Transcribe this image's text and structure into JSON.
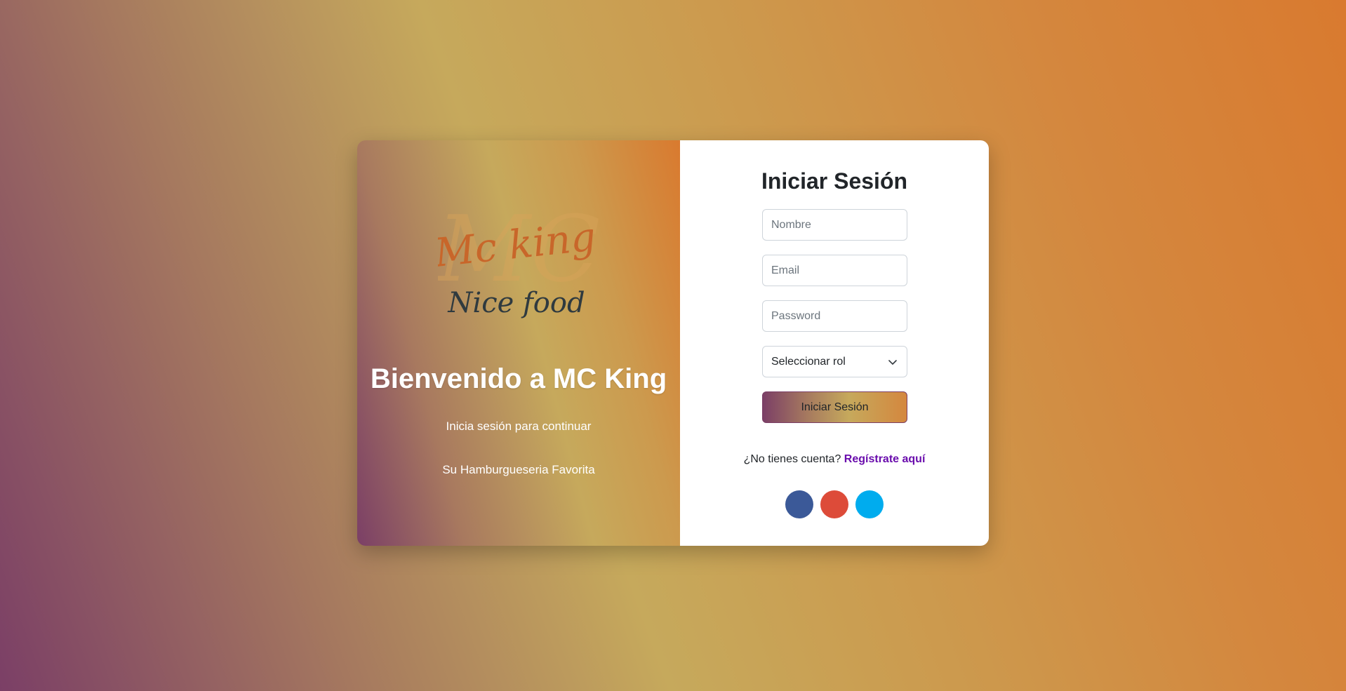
{
  "brand": {
    "logo_text": "Mc king",
    "logo_tagline": "Nice food"
  },
  "left": {
    "title": "Bienvenido a MC King",
    "subtitle": "Inicia sesión para continuar",
    "tagline": "Su Hamburgueseria Favorita"
  },
  "form": {
    "title": "Iniciar Sesión",
    "nombre_placeholder": "Nombre",
    "email_placeholder": "Email",
    "password_placeholder": "Password",
    "role_selected": "Seleccionar rol",
    "submit_label": "Iniciar Sesión",
    "no_account_text": "¿No tienes cuenta?",
    "register_link": "Regístrate aquí"
  },
  "socials": [
    {
      "name": "facebook-icon",
      "color": "#3b5998"
    },
    {
      "name": "google-icon",
      "color": "#dd4b39"
    },
    {
      "name": "twitter-icon",
      "color": "#00acee"
    }
  ],
  "colors": {
    "accent_link": "#6a0dad",
    "gradient_start": "#7b3f66",
    "gradient_mid": "#c6a95c",
    "gradient_end": "#d97a2f"
  }
}
